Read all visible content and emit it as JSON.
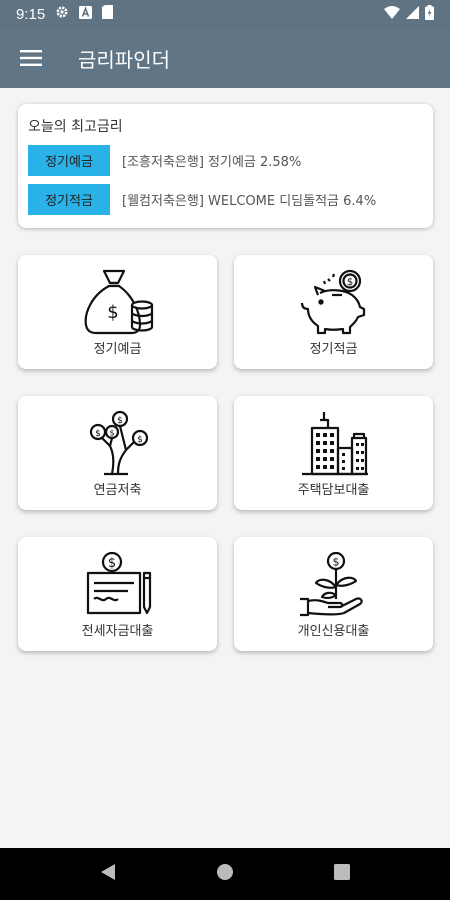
{
  "status_bar": {
    "time": "9:15"
  },
  "app_bar": {
    "title": "금리파인더"
  },
  "top_rates": {
    "heading": "오늘의 최고금리",
    "rows": [
      {
        "badge": "정기예금",
        "text": "[조흥저축은행] 정기예금 2.58%"
      },
      {
        "badge": "정기적금",
        "text": "[웰컴저축은행] WELCOME 디딤돌적금 6.4%"
      }
    ]
  },
  "tiles": [
    {
      "label": "정기예금",
      "icon": "money-bag-icon"
    },
    {
      "label": "정기적금",
      "icon": "piggy-bank-icon"
    },
    {
      "label": "연금저축",
      "icon": "money-tree-icon"
    },
    {
      "label": "주택담보대출",
      "icon": "buildings-icon"
    },
    {
      "label": "전세자금대출",
      "icon": "contract-icon"
    },
    {
      "label": "개인신용대출",
      "icon": "hand-plant-icon"
    }
  ]
}
